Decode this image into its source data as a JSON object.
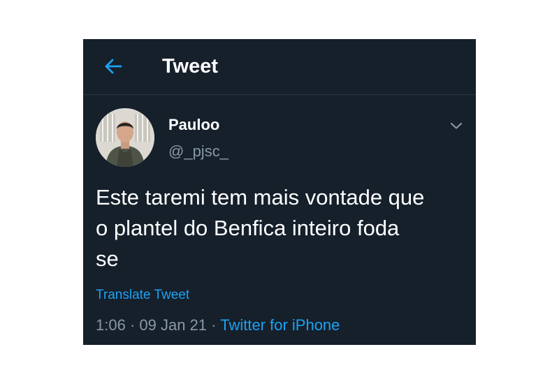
{
  "header": {
    "back_icon": "arrow-left-icon",
    "title": "Tweet"
  },
  "tweet": {
    "author": {
      "display_name": "Pauloo",
      "handle": "@_pjsc_",
      "avatar": "profile-photo"
    },
    "menu_icon": "chevron-down-icon",
    "text_lines": [
      "Este taremi tem mais vontade que",
      "o plantel do Benfica inteiro foda",
      "se"
    ],
    "translate_label": "Translate Tweet",
    "time": "1:06",
    "separator": "·",
    "date": "09 Jan 21",
    "source": "Twitter for iPhone"
  },
  "colors": {
    "background": "#15202b",
    "accent": "#1da1f2",
    "secondary_text": "#8899a6"
  }
}
